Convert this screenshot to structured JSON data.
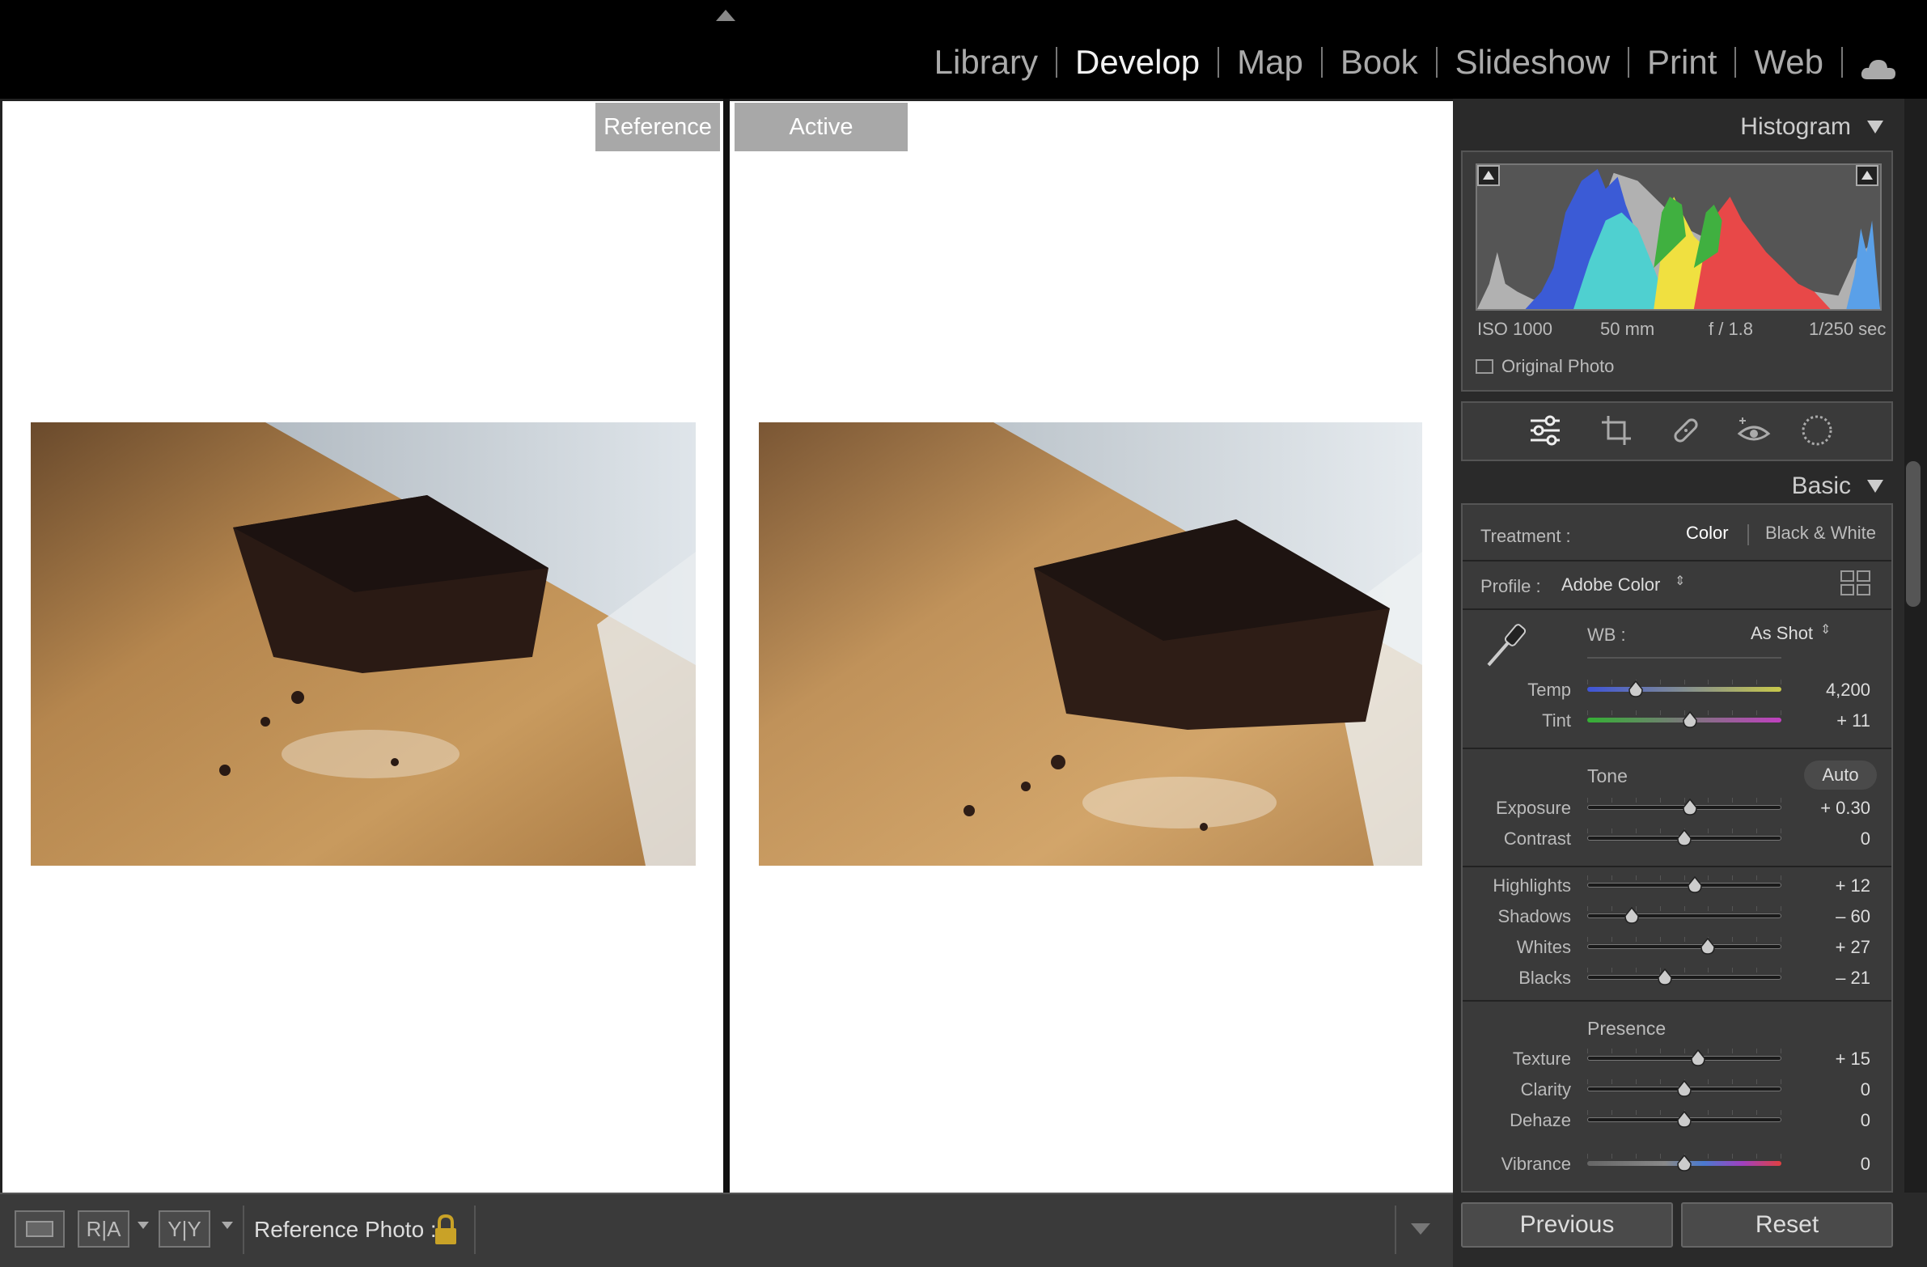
{
  "modules": {
    "library": "Library",
    "develop": "Develop",
    "map": "Map",
    "book": "Book",
    "slideshow": "Slideshow",
    "print": "Print",
    "web": "Web"
  },
  "view": {
    "reference_label": "Reference",
    "active_label": "Active"
  },
  "toolbar": {
    "ra_label": "R|A",
    "yy_label": "Y|Y",
    "reference_photo_label": "Reference Photo :"
  },
  "histogram": {
    "title": "Histogram",
    "iso": "ISO 1000",
    "focal": "50 mm",
    "aperture": "f / 1.8",
    "shutter": "1/250 sec",
    "original_photo": "Original Photo"
  },
  "basic": {
    "title": "Basic",
    "treatment_label": "Treatment :",
    "treatment_color": "Color",
    "treatment_bw": "Black & White",
    "profile_label": "Profile :",
    "profile_value": "Adobe Color",
    "wb_label": "WB :",
    "wb_value": "As Shot",
    "tone_label": "Tone",
    "auto_label": "Auto",
    "presence_label": "Presence",
    "sliders": {
      "temp": {
        "label": "Temp",
        "value": "4,200",
        "level": 0.25
      },
      "tint": {
        "label": "Tint",
        "value": "+ 11",
        "level": 0.53
      },
      "exposure": {
        "label": "Exposure",
        "value": "+ 0.30",
        "level": 0.53
      },
      "contrast": {
        "label": "Contrast",
        "value": "0",
        "level": 0.5
      },
      "highlights": {
        "label": "Highlights",
        "value": "+ 12",
        "level": 0.555
      },
      "shadows": {
        "label": "Shadows",
        "value": "– 60",
        "level": 0.23
      },
      "whites": {
        "label": "Whites",
        "value": "+ 27",
        "level": 0.62
      },
      "blacks": {
        "label": "Blacks",
        "value": "– 21",
        "level": 0.4
      },
      "texture": {
        "label": "Texture",
        "value": "+ 15",
        "level": 0.57
      },
      "clarity": {
        "label": "Clarity",
        "value": "0",
        "level": 0.5
      },
      "dehaze": {
        "label": "Dehaze",
        "value": "0",
        "level": 0.5
      },
      "vibrance": {
        "label": "Vibrance",
        "value": "0",
        "level": 0.5
      }
    }
  },
  "buttons": {
    "previous": "Previous",
    "reset": "Reset"
  }
}
